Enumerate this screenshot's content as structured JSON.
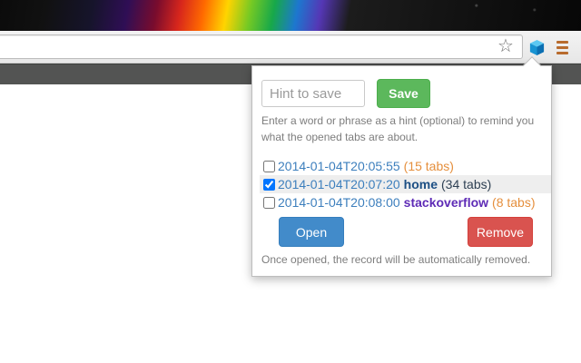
{
  "browser": {
    "icons": {
      "star": "star-icon",
      "extension": "cube-icon",
      "menu": "hamburger-menu-icon"
    },
    "star_glyph": "☆"
  },
  "popup": {
    "hint_input": {
      "placeholder": "Hint to save",
      "value": ""
    },
    "save_label": "Save",
    "hint_help": "Enter a word or phrase as a hint (optional) to remind you what the opened tabs are about.",
    "records": [
      {
        "timestamp": "2014-01-04T20:05:55",
        "name": "",
        "tabs": "(15 tabs)",
        "checked": false
      },
      {
        "timestamp": "2014-01-04T20:07:20",
        "name": "home",
        "tabs": "(34 tabs)",
        "checked": true
      },
      {
        "timestamp": "2014-01-04T20:08:00",
        "name": "stackoverflow",
        "tabs": "(8 tabs)",
        "checked": false
      }
    ],
    "open_label": "Open",
    "remove_label": "Remove",
    "remove_note": "Once opened, the record will be automatically removed."
  },
  "colors": {
    "save": "#5cb85c",
    "open": "#428bca",
    "remove": "#d9534f",
    "timestamp": "#3d7fbd",
    "hint_name": "#5e2bb6",
    "tab_count": "#e58f3d",
    "extension_icon": "#1ea7e1"
  }
}
